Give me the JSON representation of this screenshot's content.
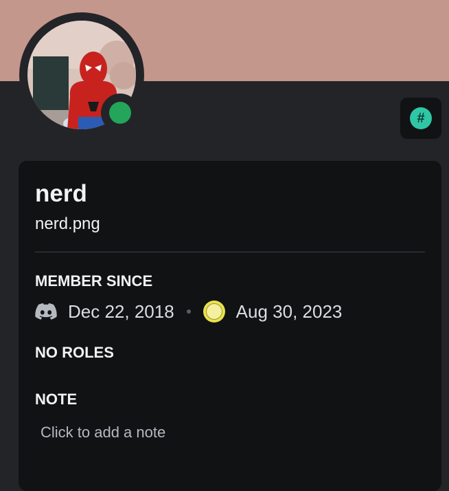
{
  "colors": {
    "banner": "#c4978d",
    "background": "#232428",
    "card": "#111214",
    "status_online": "#23a55a",
    "badge": "#2fc6a5"
  },
  "profile": {
    "avatar_icon": "spiderman-avatar",
    "status": "online",
    "badge_icon": "hashtag-icon",
    "badge_symbol": "#",
    "display_name": "nerd",
    "username": "nerd.png"
  },
  "member_since": {
    "title": "MEMBER SINCE",
    "discord_icon": "discord-logo-icon",
    "discord_date": "Dec 22, 2018",
    "server_icon": "server-icon",
    "server_date": "Aug 30, 2023"
  },
  "roles": {
    "title": "NO ROLES"
  },
  "note": {
    "title": "NOTE",
    "placeholder": "Click to add a note"
  }
}
